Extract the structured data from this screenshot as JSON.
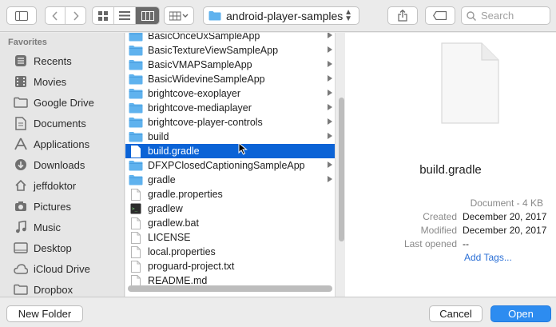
{
  "toolbar": {
    "back_icon": "chevron-left",
    "forward_icon": "chevron-right",
    "view_modes": [
      "icon-view",
      "list-view",
      "column-view"
    ],
    "active_view": "column-view",
    "location": "android-player-samples",
    "search_placeholder": "Search"
  },
  "sidebar": {
    "section_title": "Favorites",
    "items": [
      {
        "label": "Recents",
        "icon": "clock-icon"
      },
      {
        "label": "Movies",
        "icon": "film-icon"
      },
      {
        "label": "Google Drive",
        "icon": "folder-icon"
      },
      {
        "label": "Documents",
        "icon": "document-icon"
      },
      {
        "label": "Applications",
        "icon": "applications-icon"
      },
      {
        "label": "Downloads",
        "icon": "download-icon"
      },
      {
        "label": "jeffdoktor",
        "icon": "home-icon"
      },
      {
        "label": "Pictures",
        "icon": "camera-icon"
      },
      {
        "label": "Music",
        "icon": "music-icon"
      },
      {
        "label": "Desktop",
        "icon": "desktop-icon"
      },
      {
        "label": "iCloud Drive",
        "icon": "cloud-icon"
      },
      {
        "label": "Dropbox",
        "icon": "folder-icon"
      }
    ]
  },
  "files": [
    {
      "name": "BasicOnceUxSampleApp",
      "type": "folder"
    },
    {
      "name": "BasicTextureViewSampleApp",
      "type": "folder"
    },
    {
      "name": "BasicVMAPSampleApp",
      "type": "folder"
    },
    {
      "name": "BasicWidevineSampleApp",
      "type": "folder"
    },
    {
      "name": "brightcove-exoplayer",
      "type": "folder"
    },
    {
      "name": "brightcove-mediaplayer",
      "type": "folder"
    },
    {
      "name": "brightcove-player-controls",
      "type": "folder"
    },
    {
      "name": "build",
      "type": "folder"
    },
    {
      "name": "build.gradle",
      "type": "file",
      "selected": true
    },
    {
      "name": "DFXPClosedCaptioningSampleApp",
      "type": "folder"
    },
    {
      "name": "gradle",
      "type": "folder"
    },
    {
      "name": "gradle.properties",
      "type": "file"
    },
    {
      "name": "gradlew",
      "type": "exec"
    },
    {
      "name": "gradlew.bat",
      "type": "file"
    },
    {
      "name": "LICENSE",
      "type": "file"
    },
    {
      "name": "local.properties",
      "type": "file"
    },
    {
      "name": "proguard-project.txt",
      "type": "file"
    },
    {
      "name": "README.md",
      "type": "file"
    }
  ],
  "preview": {
    "name": "build.gradle",
    "kind": "Document - 4 KB",
    "created_label": "Created",
    "created_value": "December 20, 2017",
    "modified_label": "Modified",
    "modified_value": "December 20, 2017",
    "last_opened_label": "Last opened",
    "last_opened_value": "--",
    "add_tags": "Add Tags..."
  },
  "buttons": {
    "new_folder": "New Folder",
    "cancel": "Cancel",
    "open": "Open"
  },
  "colors": {
    "selection": "#0b63d6",
    "folder": "#5fb2ee",
    "primary_button": "#2d8cf0"
  }
}
